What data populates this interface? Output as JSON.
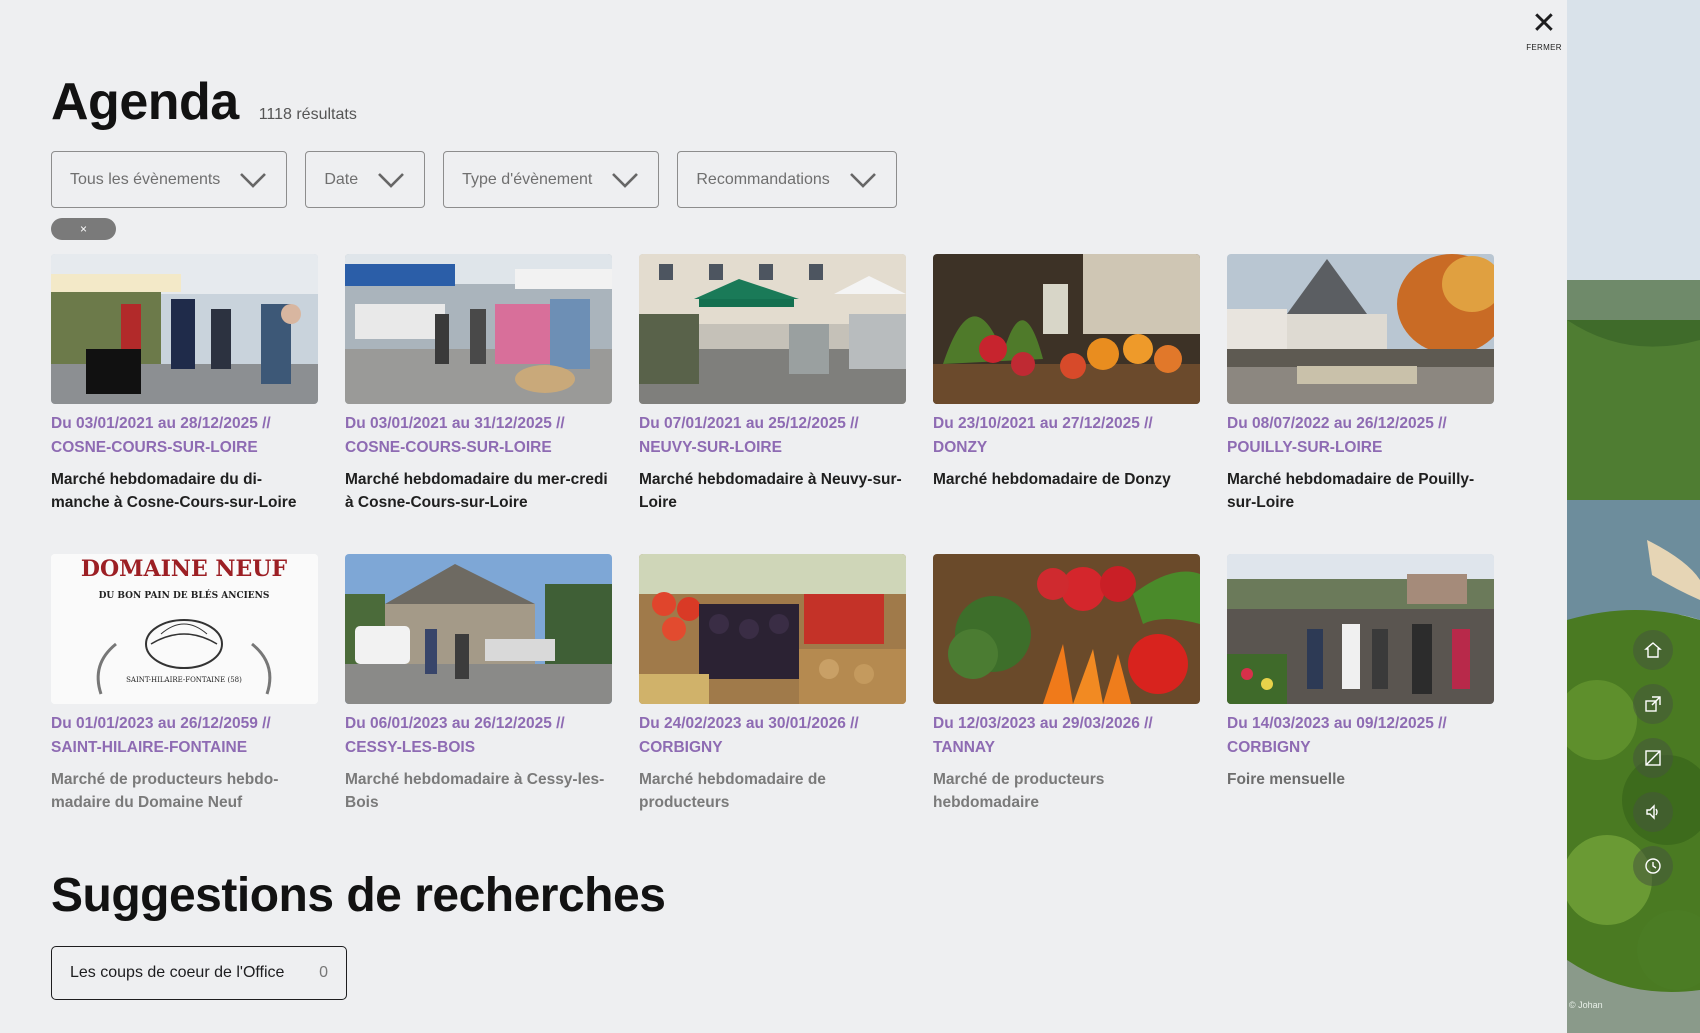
{
  "close": {
    "label": "FERMER"
  },
  "header": {
    "title": "Agenda",
    "count": "1118 résultats"
  },
  "filters": [
    {
      "label": "Tous les évènements"
    },
    {
      "label": "Date"
    },
    {
      "label": "Type d'évènement"
    },
    {
      "label": "Recommandations"
    }
  ],
  "reset_chip": {
    "label": "×"
  },
  "events": [
    {
      "date": "Du 03/01/2021 au 28/12/2025 //",
      "city": "COSNE-COURS-SUR-LOIRE",
      "title": "Marché hebdomadaire du di-manche à Cosne-Cours-sur-Loire"
    },
    {
      "date": "Du 03/01/2021 au 31/12/2025 //",
      "city": "COSNE-COURS-SUR-LOIRE",
      "title": "Marché hebdomadaire du mer-credi à Cosne-Cours-sur-Loire"
    },
    {
      "date": "Du 07/01/2021 au 25/12/2025 //",
      "city": "NEUVY-SUR-LOIRE",
      "title": "Marché hebdomadaire à Neuvy-sur-Loire"
    },
    {
      "date": "Du 23/10/2021 au 27/12/2025 //",
      "city": "DONZY",
      "title": "Marché hebdomadaire de Donzy"
    },
    {
      "date": "Du 08/07/2022 au 26/12/2025 //",
      "city": "POUILLY-SUR-LOIRE",
      "title": "Marché hebdomadaire de Pouilly-sur-Loire"
    },
    {
      "date": "Du 01/01/2023 au 26/12/2059 //",
      "city": "SAINT-HILAIRE-FONTAINE",
      "title": "Marché de producteurs hebdo-madaire du Domaine Neuf"
    },
    {
      "date": "Du 06/01/2023 au 26/12/2025 //",
      "city": "CESSY-LES-BOIS",
      "title": "Marché hebdomadaire à Cessy-les-Bois"
    },
    {
      "date": "Du 24/02/2023 au 30/01/2026 //",
      "city": "CORBIGNY",
      "title": "Marché hebdomadaire de producteurs"
    },
    {
      "date": "Du 12/03/2023 au 29/03/2026 //",
      "city": "TANNAY",
      "title": "Marché de producteurs hebdomadaire"
    },
    {
      "date": "Du 14/03/2023 au 09/12/2025 //",
      "city": "CORBIGNY",
      "title": "Foire mensuelle"
    }
  ],
  "logo_text": {
    "line1": "DOMAINE NEUF",
    "line2": "DU BON PAIN DE BLÉS ANCIENS",
    "line3": "SAINT-HILAIRE-FONTAINE (58)"
  },
  "suggestions": {
    "title": "Suggestions de recherches",
    "chip_label": "Les coups de coeur de l'Office",
    "chip_count": "0"
  },
  "side_icons": [
    "home-icon",
    "share-icon",
    "accessibility-icon",
    "sound-icon",
    "history-icon"
  ],
  "credit": "© Johan"
}
